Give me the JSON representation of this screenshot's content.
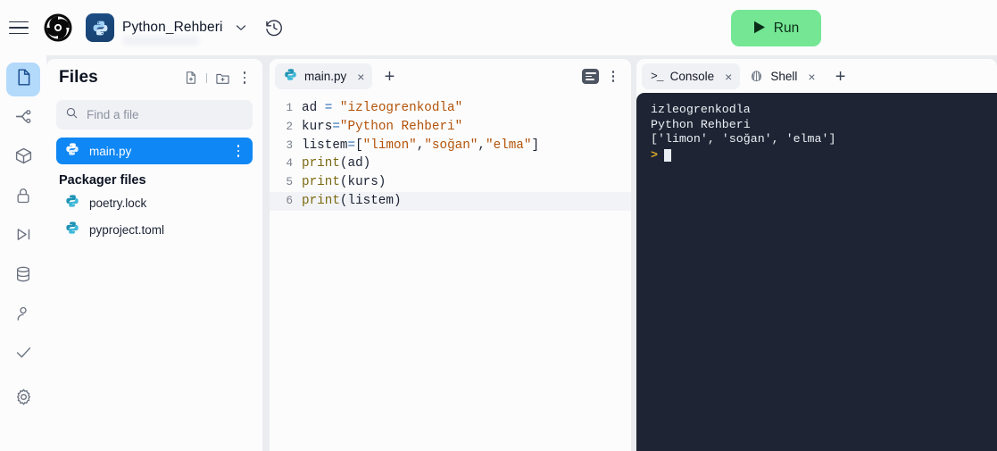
{
  "topbar": {
    "menu_icon": "hamburger-menu-icon",
    "logo_icon": "replit-logo-icon",
    "project_icon": "python-badge-icon",
    "project_name": "Python_Rehberi",
    "dropdown_icon": "chevron-down-icon",
    "history_icon": "history-clock-icon",
    "run_label": "Run",
    "run_icon": "play-icon",
    "run_color": "#74e694"
  },
  "rail": {
    "items": [
      {
        "name": "files",
        "icon": "file-icon",
        "active": true
      },
      {
        "name": "git",
        "icon": "git-branch-icon",
        "active": false
      },
      {
        "name": "packages",
        "icon": "package-cube-icon",
        "active": false
      },
      {
        "name": "secrets",
        "icon": "lock-icon",
        "active": false
      },
      {
        "name": "deployments",
        "icon": "play-to-end-icon",
        "active": false
      },
      {
        "name": "database",
        "icon": "database-icon",
        "active": false
      },
      {
        "name": "authentication",
        "icon": "user-icon",
        "active": false
      },
      {
        "name": "checks",
        "icon": "checkmark-icon",
        "active": false
      },
      {
        "name": "settings",
        "icon": "gear-icon",
        "active": false
      }
    ]
  },
  "files": {
    "title": "Files",
    "new_file_icon": "new-file-icon",
    "new_folder_icon": "new-folder-icon",
    "menu_icon": "kebab-menu-icon",
    "search": {
      "placeholder": "Find a file",
      "value": "",
      "icon": "search-icon"
    },
    "items": [
      {
        "name": "main.py",
        "icon": "python-file-icon",
        "selected": true
      }
    ],
    "group_title": "Packager files",
    "packager_items": [
      {
        "name": "poetry.lock",
        "icon": "python-file-icon"
      },
      {
        "name": "pyproject.toml",
        "icon": "python-file-icon"
      }
    ],
    "selected_color": "#0f87f5"
  },
  "editor": {
    "tabs": [
      {
        "label": "main.py",
        "icon": "python-file-icon",
        "active": true,
        "close_icon": "close-icon"
      }
    ],
    "add_tab_icon": "plus-icon",
    "format_icon": "format-lines-icon",
    "menu_icon": "kebab-menu-icon",
    "lines": [
      {
        "num": "1",
        "tokens": [
          {
            "t": "ad ",
            "c": "pl"
          },
          {
            "t": "= ",
            "c": "op"
          },
          {
            "t": "\"izleogrenkodla\"",
            "c": "str"
          }
        ]
      },
      {
        "num": "2",
        "tokens": [
          {
            "t": "kurs",
            "c": "pl"
          },
          {
            "t": "=",
            "c": "op"
          },
          {
            "t": "\"Python Rehberi\"",
            "c": "str"
          }
        ]
      },
      {
        "num": "3",
        "tokens": [
          {
            "t": "listem",
            "c": "pl"
          },
          {
            "t": "=",
            "c": "op"
          },
          {
            "t": "[",
            "c": "pl"
          },
          {
            "t": "\"limon\"",
            "c": "str"
          },
          {
            "t": ",",
            "c": "pl"
          },
          {
            "t": "\"soğan\"",
            "c": "str"
          },
          {
            "t": ",",
            "c": "pl"
          },
          {
            "t": "\"elma\"",
            "c": "str"
          },
          {
            "t": "]",
            "c": "pl"
          }
        ]
      },
      {
        "num": "4",
        "tokens": [
          {
            "t": "print",
            "c": "fn"
          },
          {
            "t": "(ad)",
            "c": "pl"
          }
        ]
      },
      {
        "num": "5",
        "tokens": [
          {
            "t": "print",
            "c": "fn"
          },
          {
            "t": "(kurs)",
            "c": "pl"
          }
        ]
      },
      {
        "num": "6",
        "active": true,
        "tokens": [
          {
            "t": "print",
            "c": "fn"
          },
          {
            "t": "(listem)",
            "c": "pl"
          }
        ]
      }
    ]
  },
  "console": {
    "tabs": [
      {
        "label": "Console",
        "icon": "terminal-prompt-icon",
        "active": true,
        "close_icon": "close-icon"
      },
      {
        "label": "Shell",
        "icon": "shell-icon",
        "active": false,
        "close_icon": "close-icon"
      }
    ],
    "add_tab_icon": "plus-icon",
    "background": "#1e2433",
    "output_lines": [
      "izleogrenkodla",
      "Python Rehberi",
      "['limon', 'soğan', 'elma']"
    ],
    "prompt_symbol": ">",
    "prompt_value": ""
  }
}
